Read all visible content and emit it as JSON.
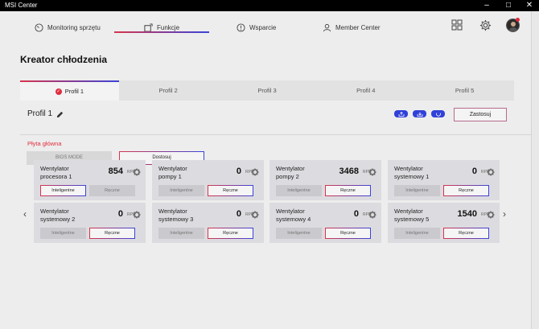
{
  "window": {
    "title": "MSI Center",
    "minimize": "–",
    "maximize": "□",
    "close": "✕"
  },
  "nav": {
    "tabs": [
      {
        "label": "Monitoring sprzętu",
        "icon": "gauge-icon"
      },
      {
        "label": "Funkcje",
        "icon": "features-icon",
        "active": true
      },
      {
        "label": "Wsparcie",
        "icon": "support-icon"
      },
      {
        "label": "Member Center",
        "icon": "user-icon"
      }
    ]
  },
  "page": {
    "title": "Kreator chłodzenia"
  },
  "profiles": {
    "tabs": [
      "Profil 1",
      "Profil 2",
      "Profil 3",
      "Profil 4",
      "Profil 5"
    ],
    "active_index": 0,
    "current_name": "Profil 1",
    "apply_label": "Zastosuj"
  },
  "section": {
    "label": "Płyta główna",
    "modes": [
      "BIOS MODE",
      "Dostosuj"
    ],
    "active_mode": "Dostosuj"
  },
  "fans": [
    {
      "name": "Wentylator procesora 1",
      "rpm": "854",
      "unit": "RPM",
      "mode_smart": "Inteligentne",
      "mode_manual": "Ręczne",
      "active": "smart"
    },
    {
      "name": "Wentylator pompy 1",
      "rpm": "0",
      "unit": "RPM",
      "mode_smart": "Inteligentne",
      "mode_manual": "Ręczne",
      "active": "manual"
    },
    {
      "name": "Wentylator pompy 2",
      "rpm": "3468",
      "unit": "RPM",
      "mode_smart": "Inteligentne",
      "mode_manual": "Ręczne",
      "active": "manual"
    },
    {
      "name": "Wentylator systemowy 1",
      "rpm": "0",
      "unit": "RPM",
      "mode_smart": "Inteligentne",
      "mode_manual": "Ręczne",
      "active": "manual"
    },
    {
      "name": "Wentylator systemowy 2",
      "rpm": "0",
      "unit": "RPM",
      "mode_smart": "Inteligentne",
      "mode_manual": "Ręczne",
      "active": "manual"
    },
    {
      "name": "Wentylator systemowy 3",
      "rpm": "0",
      "unit": "RPM",
      "mode_smart": "Inteligentne",
      "mode_manual": "Ręczne",
      "active": "manual"
    },
    {
      "name": "Wentylator systemowy 4",
      "rpm": "0",
      "unit": "RPM",
      "mode_smart": "Inteligentne",
      "mode_manual": "Ręczne",
      "active": "manual"
    },
    {
      "name": "Wentylator systemowy 5",
      "rpm": "1540",
      "unit": "RPM",
      "mode_smart": "Inteligentne",
      "mode_manual": "Ręczne",
      "active": "manual"
    }
  ],
  "carousel": {
    "prev": "‹",
    "next": "›"
  },
  "colors": {
    "accent_red": "#e0303e",
    "accent_blue": "#3040d8",
    "background": "#ededed",
    "card": "#dcdce0"
  }
}
